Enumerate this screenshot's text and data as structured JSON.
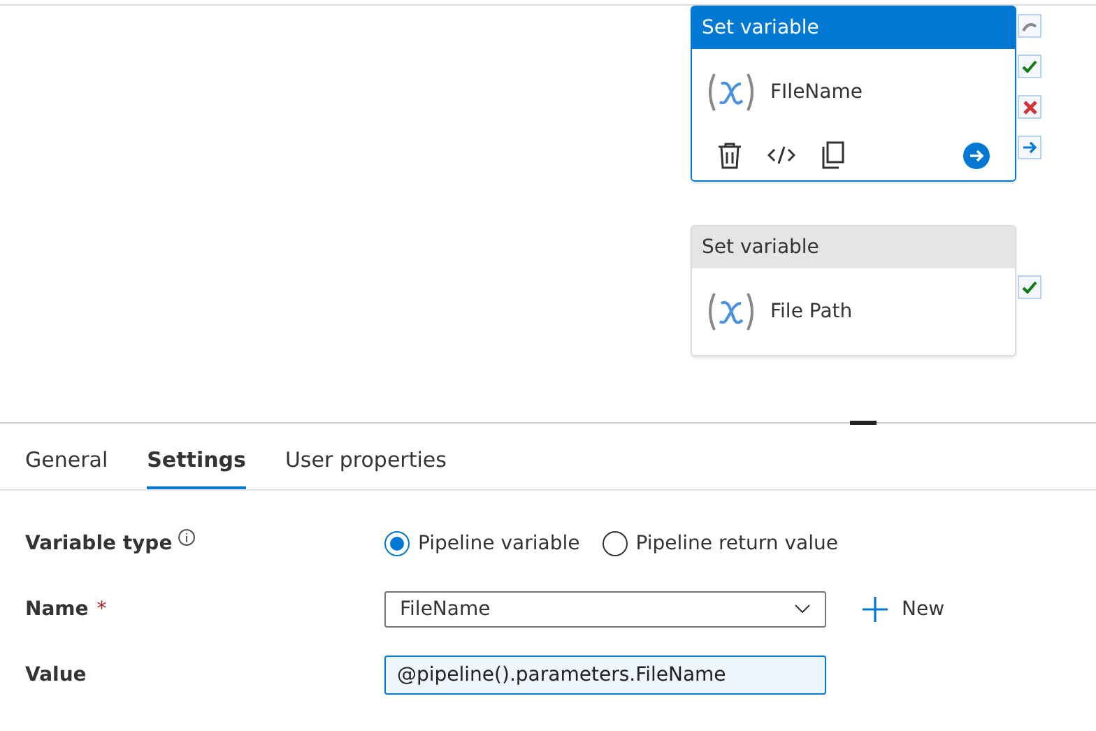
{
  "canvas": {
    "nodes": [
      {
        "title": "Set variable",
        "name": "FIleName",
        "selected": true,
        "outputs": [
          {
            "kind": "skip"
          },
          {
            "kind": "success"
          },
          {
            "kind": "failure"
          },
          {
            "kind": "completion"
          }
        ]
      },
      {
        "title": "Set variable",
        "name": "File Path",
        "selected": false,
        "outputs": [
          {
            "kind": "success"
          }
        ]
      }
    ]
  },
  "tabs": [
    {
      "label": "General",
      "selected": false
    },
    {
      "label": "Settings",
      "selected": true
    },
    {
      "label": "User properties",
      "selected": false
    }
  ],
  "settings": {
    "variable_type": {
      "label": "Variable type",
      "options": [
        {
          "label": "Pipeline variable",
          "selected": true
        },
        {
          "label": "Pipeline return value",
          "selected": false
        }
      ]
    },
    "name": {
      "label": "Name",
      "required_mark": "*",
      "value": "FileName",
      "new_button": "New"
    },
    "value": {
      "label": "Value",
      "value": "@pipeline().parameters.FileName"
    }
  }
}
